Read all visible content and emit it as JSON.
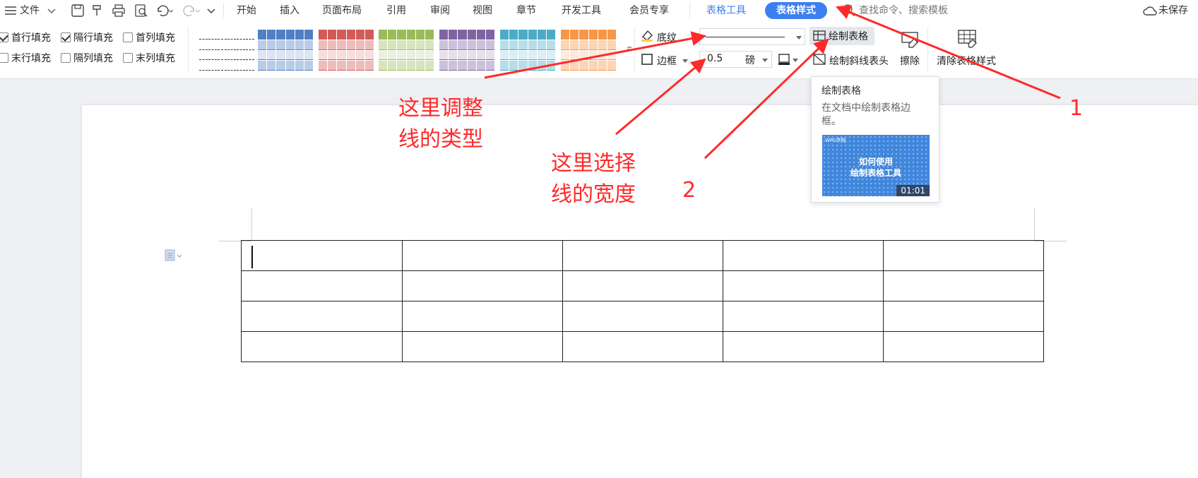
{
  "menubar": {
    "menu_label": "文件",
    "tabs": [
      {
        "label": "开始"
      },
      {
        "label": "插入"
      },
      {
        "label": "页面布局"
      },
      {
        "label": "引用"
      },
      {
        "label": "审阅"
      },
      {
        "label": "视图"
      },
      {
        "label": "章节"
      },
      {
        "label": "开发工具"
      },
      {
        "label": "会员专享"
      },
      {
        "label": "表格工具"
      },
      {
        "label": "表格样式"
      }
    ],
    "search_placeholder": "查找命令、搜索模板",
    "save_status": "未保存"
  },
  "ribbon": {
    "checkboxes": [
      {
        "label": "首行填充",
        "checked": true
      },
      {
        "label": "隔行填充",
        "checked": true
      },
      {
        "label": "首列填充",
        "checked": false
      },
      {
        "label": "末行填充",
        "checked": false
      },
      {
        "label": "隔列填充",
        "checked": false
      },
      {
        "label": "末列填充",
        "checked": false
      }
    ],
    "style_colors": [
      "#ffffff",
      "#4f7fc4",
      "#d25a57",
      "#9bbb59",
      "#8064a2",
      "#4bacc6",
      "#f79646"
    ],
    "shading_label": "底纹",
    "border_label": "边框",
    "line_width_value": "0.5",
    "line_width_unit": "磅",
    "draw_table_label": "绘制表格",
    "draw_diagonal_label": "绘制斜线表头",
    "erase_label": "擦除",
    "clear_style_label": "清除表格样式"
  },
  "tooltip": {
    "title": "绘制表格",
    "description": "在文档中绘制表格边框。",
    "video_badge": "WPS学院",
    "video_title_line1": "如何使用",
    "video_title_line2": "绘制表格工具",
    "video_duration": "01:01"
  },
  "annotations": {
    "line_type_line1": "这里调整",
    "line_type_line2": "线的类型",
    "line_width_line1": "这里选择",
    "line_width_line2": "线的宽度",
    "num1": "1",
    "num2": "2",
    "color": "#ff2a2a"
  },
  "document": {
    "table_rows": 4,
    "table_cols": 5
  }
}
